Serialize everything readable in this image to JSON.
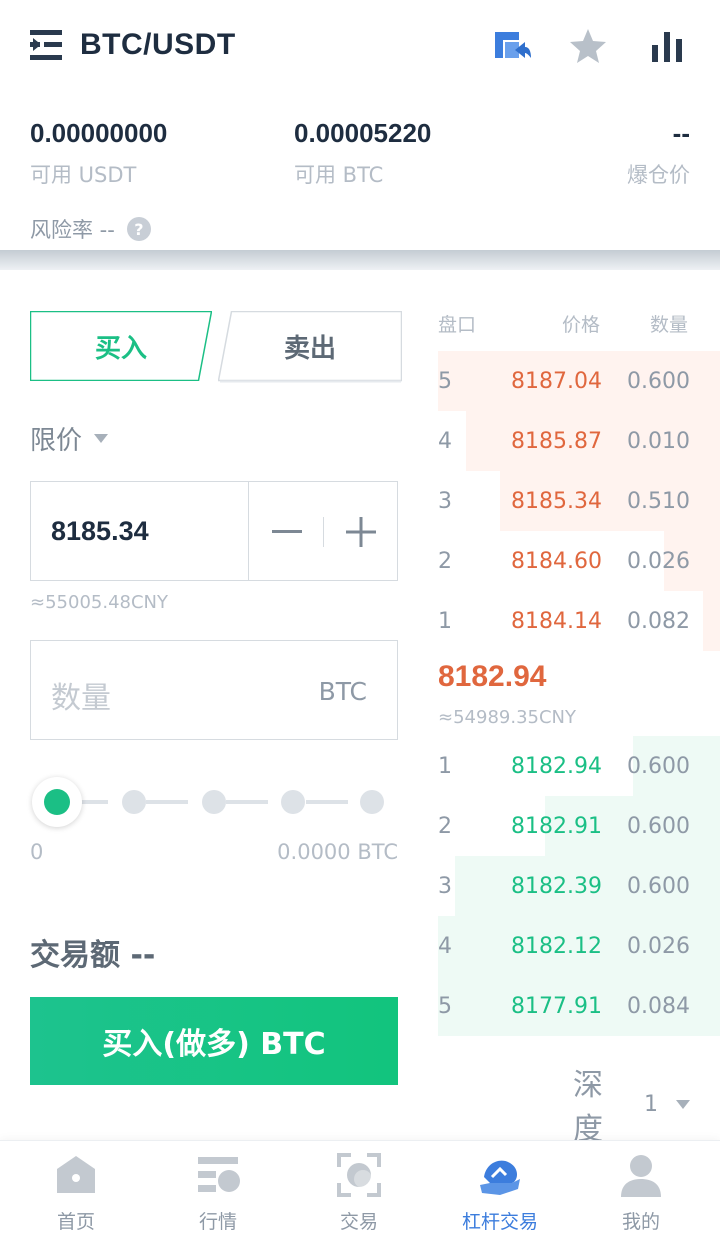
{
  "header": {
    "pair": "BTC/USDT",
    "icons": [
      "menu-icon",
      "transfer-icon",
      "star-icon",
      "chart-icon"
    ]
  },
  "balances": [
    {
      "value": "0.00000000",
      "label": "可用 USDT"
    },
    {
      "value": "0.00005220",
      "label": "可用 BTC"
    },
    {
      "value": "--",
      "label": "爆仓价"
    }
  ],
  "risk": {
    "label": "风险率 --"
  },
  "form": {
    "buy_tab": "买入",
    "sell_tab": "卖出",
    "order_type": "限价",
    "price": "8185.34",
    "price_cny": "≈55005.48CNY",
    "qty_placeholder": "数量",
    "qty_unit": "BTC",
    "slider_min": "0",
    "slider_max": "0.0000 BTC",
    "slider_level": 0,
    "trade_amount": "交易额 --",
    "submit": "买入(做多) BTC"
  },
  "orderbook": {
    "headers": {
      "book": "盘口",
      "price": "价格",
      "qty": "数量"
    },
    "asks": [
      {
        "idx": "5",
        "price": "8187.04",
        "qty": "0.600",
        "depth": 1.0
      },
      {
        "idx": "4",
        "price": "8185.87",
        "qty": "0.010",
        "depth": 0.9
      },
      {
        "idx": "3",
        "price": "8185.34",
        "qty": "0.510",
        "depth": 0.78
      },
      {
        "idx": "2",
        "price": "8184.60",
        "qty": "0.026",
        "depth": 0.2
      },
      {
        "idx": "1",
        "price": "8184.14",
        "qty": "0.082",
        "depth": 0.06
      }
    ],
    "last_price": "8182.94",
    "last_price_cny": "≈54989.35CNY",
    "bids": [
      {
        "idx": "1",
        "price": "8182.94",
        "qty": "0.600",
        "depth": 0.31
      },
      {
        "idx": "2",
        "price": "8182.91",
        "qty": "0.600",
        "depth": 0.62
      },
      {
        "idx": "3",
        "price": "8182.39",
        "qty": "0.600",
        "depth": 0.94
      },
      {
        "idx": "4",
        "price": "8182.12",
        "qty": "0.026",
        "depth": 1.0
      },
      {
        "idx": "5",
        "price": "8177.91",
        "qty": "0.084",
        "depth": 1.0
      }
    ],
    "depth_label": "深度",
    "depth_value": "1"
  },
  "nav": [
    {
      "label": "首页",
      "icon": "home-icon",
      "active": false
    },
    {
      "label": "行情",
      "icon": "market-icon",
      "active": false
    },
    {
      "label": "交易",
      "icon": "trade-icon",
      "active": false
    },
    {
      "label": "杠杆交易",
      "icon": "margin-icon",
      "active": true
    },
    {
      "label": "我的",
      "icon": "profile-icon",
      "active": false
    }
  ],
  "colors": {
    "green": "#1bbf85",
    "red": "#e0673e",
    "blue": "#3c7ddd"
  }
}
